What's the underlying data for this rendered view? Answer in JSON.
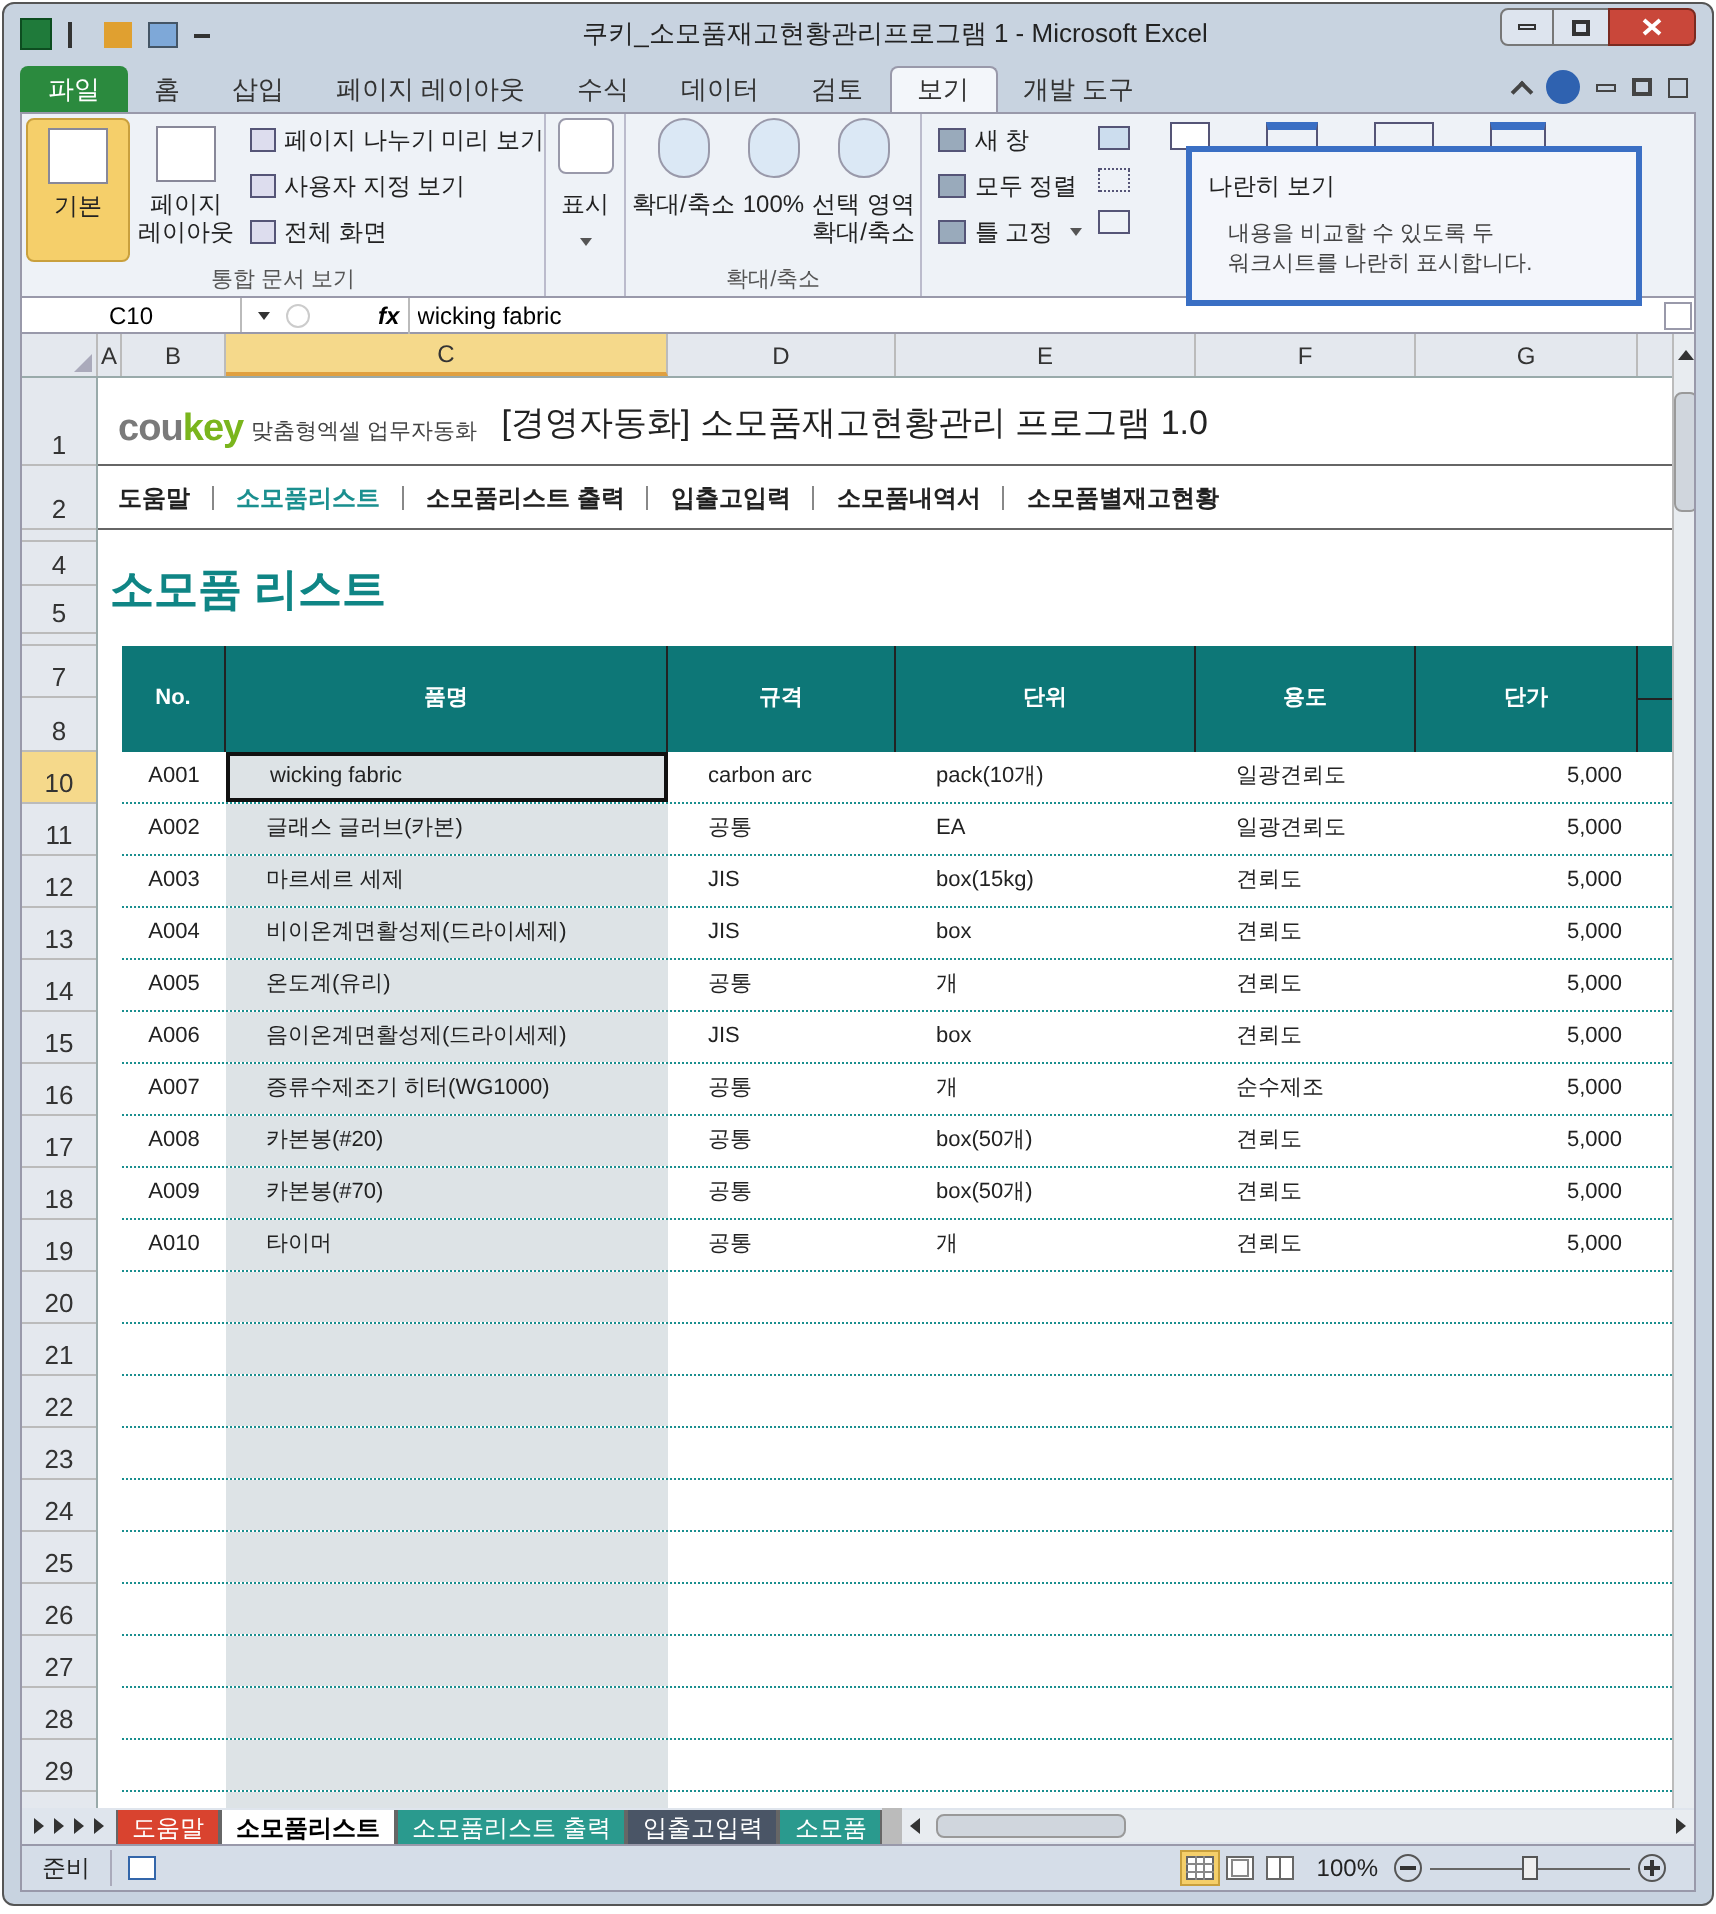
{
  "window": {
    "title": "쿠키_소모품재고현황관리프로그램 1  -  Microsoft Excel"
  },
  "ribbon_tabs": [
    {
      "label": "파일",
      "kind": "file",
      "selected": false
    },
    {
      "label": "홈",
      "kind": "tab",
      "selected": false
    },
    {
      "label": "삽입",
      "kind": "tab",
      "selected": false
    },
    {
      "label": "페이지 레이아웃",
      "kind": "tab",
      "selected": false
    },
    {
      "label": "수식",
      "kind": "tab",
      "selected": false
    },
    {
      "label": "데이터",
      "kind": "tab",
      "selected": false
    },
    {
      "label": "검토",
      "kind": "tab",
      "selected": false
    },
    {
      "label": "보기",
      "kind": "tab",
      "selected": true
    },
    {
      "label": "개발 도구",
      "kind": "tab",
      "selected": false
    }
  ],
  "ribbon": {
    "workbook_views": {
      "group_label": "통합 문서 보기",
      "large_buttons": [
        {
          "label": "기본",
          "selected": true
        },
        {
          "label": "페이지\n레이아웃",
          "selected": false
        }
      ],
      "small_buttons": [
        "페이지 나누기 미리 보기",
        "사용자 지정 보기",
        "전체 화면"
      ]
    },
    "show": {
      "label": "표시"
    },
    "zoom": {
      "group_label": "확대/축소",
      "buttons": [
        "확대/축소",
        "100%",
        "선택 영역\n확대/축소"
      ]
    },
    "window_group": {
      "small_buttons": [
        {
          "label": "새 창",
          "dropdown": false
        },
        {
          "label": "모두 정렬",
          "dropdown": false
        },
        {
          "label": "틀 고정",
          "dropdown": true
        }
      ]
    }
  },
  "tooltip": {
    "title": "나란히 보기",
    "description": "내용을 비교할 수 있도록 두\n워크시트를 나란히 표시합니다."
  },
  "formula_bar": {
    "cell_ref": "C10",
    "fx": "fx",
    "formula": "wicking fabric"
  },
  "columns": [
    {
      "label": "A",
      "selected": false
    },
    {
      "label": "B",
      "selected": false
    },
    {
      "label": "C",
      "selected": true
    },
    {
      "label": "D",
      "selected": false
    },
    {
      "label": "E",
      "selected": false
    },
    {
      "label": "F",
      "selected": false
    },
    {
      "label": "G",
      "selected": false
    }
  ],
  "row_headers": [
    {
      "label": "1",
      "selected": false
    },
    {
      "label": "2",
      "selected": false
    },
    {
      "label": "4",
      "selected": false
    },
    {
      "label": "5",
      "selected": false
    },
    {
      "label": "7",
      "selected": false
    },
    {
      "label": "8",
      "selected": false
    },
    {
      "label": "10",
      "selected": true
    },
    {
      "label": "11",
      "selected": false
    },
    {
      "label": "12",
      "selected": false
    },
    {
      "label": "13",
      "selected": false
    },
    {
      "label": "14",
      "selected": false
    },
    {
      "label": "15",
      "selected": false
    },
    {
      "label": "16",
      "selected": false
    },
    {
      "label": "17",
      "selected": false
    },
    {
      "label": "18",
      "selected": false
    },
    {
      "label": "19",
      "selected": false
    },
    {
      "label": "20",
      "selected": false
    },
    {
      "label": "21",
      "selected": false
    },
    {
      "label": "22",
      "selected": false
    },
    {
      "label": "23",
      "selected": false
    },
    {
      "label": "24",
      "selected": false
    },
    {
      "label": "25",
      "selected": false
    },
    {
      "label": "26",
      "selected": false
    },
    {
      "label": "27",
      "selected": false
    },
    {
      "label": "28",
      "selected": false
    },
    {
      "label": "29",
      "selected": false
    }
  ],
  "sheet": {
    "logo": [
      {
        "text": "cou",
        "color": "#7a7a7a"
      },
      {
        "text": "key",
        "color": "#7ab51d"
      }
    ],
    "tagline": "맞춤형엑셀 업무자동화",
    "title": "[경영자동화] 소모품재고현황관리 프로그램 1.0",
    "nav": [
      {
        "label": "도움말",
        "selected": false
      },
      {
        "label": "소모품리스트",
        "selected": true
      },
      {
        "label": "소모품리스트 출력",
        "selected": false
      },
      {
        "label": "입출고입력",
        "selected": false
      },
      {
        "label": "소모품내역서",
        "selected": false
      },
      {
        "label": "소모품별재고현황",
        "selected": false
      }
    ],
    "heading": "소모품 리스트",
    "table": {
      "columns": [
        "No.",
        "품명",
        "규격",
        "단위",
        "용도",
        "단가"
      ],
      "rows": [
        [
          "A001",
          "wicking fabric",
          "carbon arc",
          "pack(10개)",
          "일광견뢰도",
          "5,000"
        ],
        [
          "A002",
          "글래스 글러브(카본)",
          "공통",
          "EA",
          "일광견뢰도",
          "5,000"
        ],
        [
          "A003",
          "마르세르 세제",
          "JIS",
          "box(15kg)",
          "견뢰도",
          "5,000"
        ],
        [
          "A004",
          "비이온계면활성제(드라이세제)",
          "JIS",
          "box",
          "견뢰도",
          "5,000"
        ],
        [
          "A005",
          "온도계(유리)",
          "공통",
          "개",
          "견뢰도",
          "5,000"
        ],
        [
          "A006",
          "음이온계면활성제(드라이세제)",
          "JIS",
          "box",
          "견뢰도",
          "5,000"
        ],
        [
          "A007",
          "증류수제조기 히터(WG1000)",
          "공통",
          "개",
          "순수제조",
          "5,000"
        ],
        [
          "A008",
          "카본봉(#20)",
          "공통",
          "box(50개)",
          "견뢰도",
          "5,000"
        ],
        [
          "A009",
          "카본봉(#70)",
          "공통",
          "box(50개)",
          "견뢰도",
          "5,000"
        ],
        [
          "A010",
          "타이머",
          "공통",
          "개",
          "견뢰도",
          "5,000"
        ]
      ]
    }
  },
  "sheet_tabs": [
    {
      "label": "도움말",
      "selected": false,
      "color": "#d9432f"
    },
    {
      "label": "소모품리스트",
      "selected": true,
      "color": "#ffffff"
    },
    {
      "label": "소모품리스트 출력",
      "selected": false,
      "color": "#2a9a8e"
    },
    {
      "label": "입출고입력",
      "selected": false,
      "color": "#4a5566"
    },
    {
      "label": "소모품",
      "selected": false,
      "color": "#2a9a8e"
    }
  ],
  "status_bar": {
    "status": "준비",
    "view_buttons": [
      {
        "kind": "normal",
        "selected": true
      },
      {
        "kind": "page-layout",
        "selected": false
      },
      {
        "kind": "page-break",
        "selected": false
      }
    ],
    "zoom": "100%",
    "zoom_slider": {
      "level": 0.5
    }
  }
}
